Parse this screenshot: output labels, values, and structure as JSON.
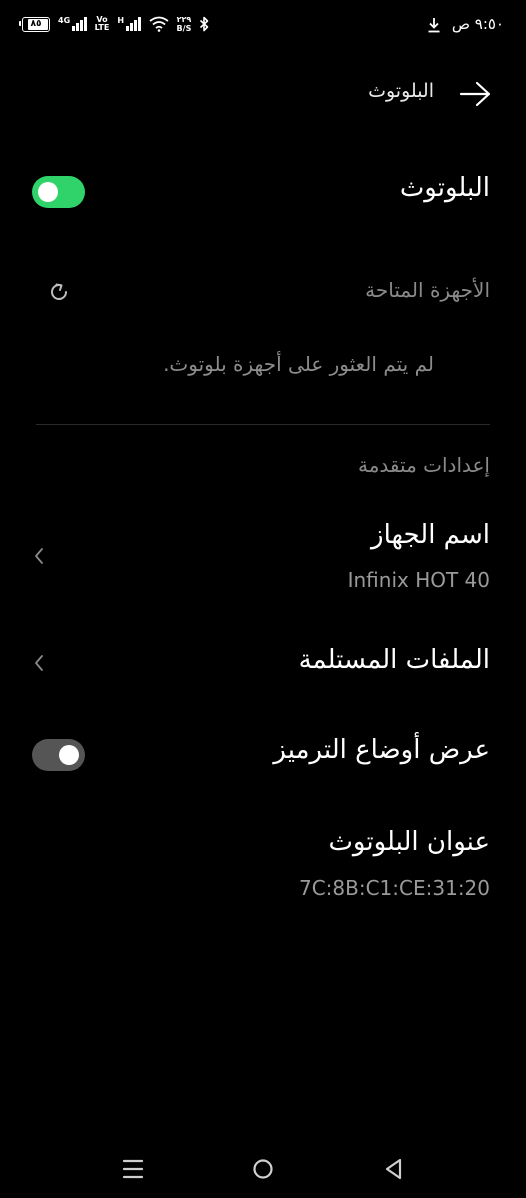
{
  "status_bar": {
    "time": "٩:٥٠ ص",
    "battery": "٨٥",
    "battery_level_percent": 85,
    "net_4g": "4G",
    "volte_top": "Vo",
    "volte_bottom": "LTE",
    "net_h": "H",
    "speed_value": "٢٢٩",
    "speed_unit": "B/S"
  },
  "header": {
    "title": "البلوتوث"
  },
  "bluetooth": {
    "label": "البلوتوث",
    "enabled": true
  },
  "available_devices": {
    "label": "الأجهزة المتاحة",
    "empty_message": "لم يتم العثور على أجهزة بلوتوث."
  },
  "advanced": {
    "label": "إعدادات متقدمة",
    "device_name": {
      "title": "اسم الجهاز",
      "value": "Infinix HOT 40"
    },
    "received_files": {
      "title": "الملفات المستلمة"
    },
    "show_codecs": {
      "title": "عرض أوضاع الترميز",
      "enabled": false
    },
    "bluetooth_address": {
      "title": "عنوان البلوتوث",
      "value": "7C:8B:C1:CE:31:20"
    }
  },
  "colors": {
    "background": "#000000",
    "accent_green": "#2fd36a",
    "secondary_text": "#9a9a9a"
  },
  "nav_bar": {
    "icons": [
      "menu-icon",
      "home-icon",
      "back-icon"
    ]
  }
}
